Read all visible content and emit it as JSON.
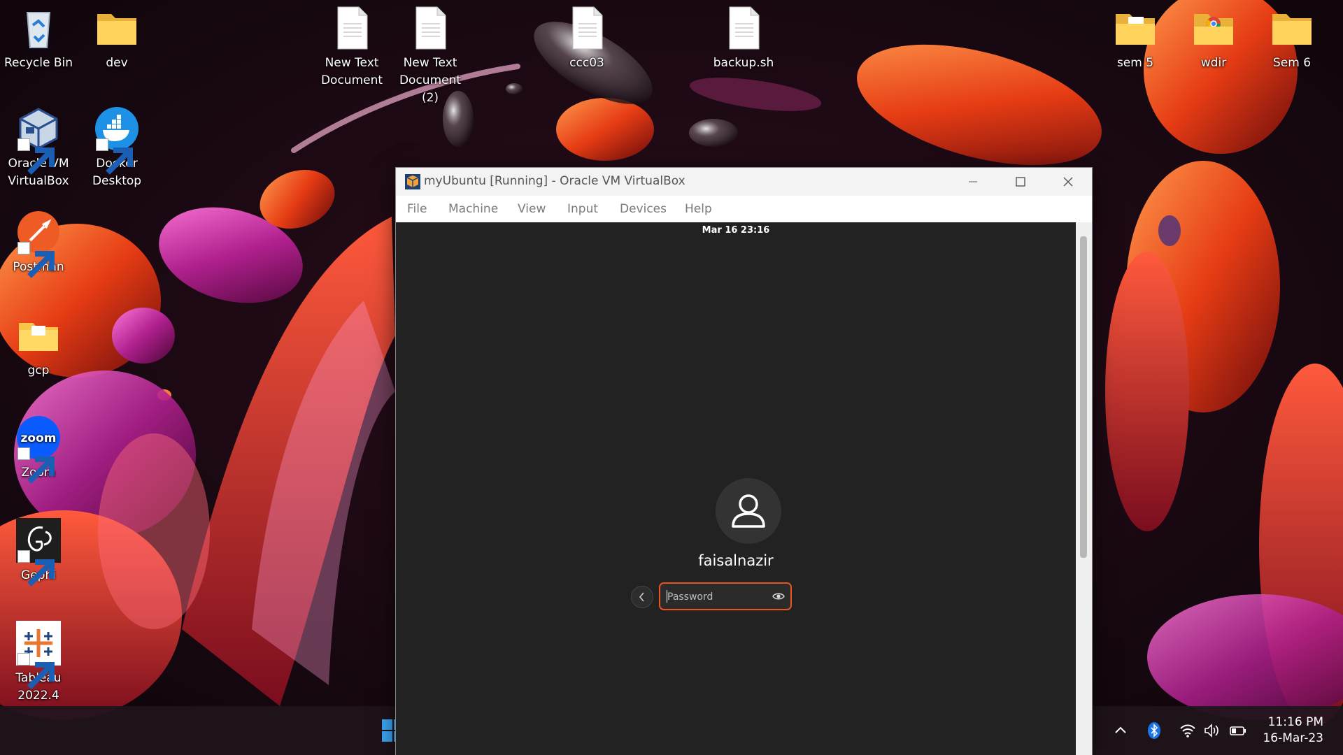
{
  "desktop": {
    "icons": [
      {
        "label": "Recycle Bin",
        "icon": "recycle-bin-icon"
      },
      {
        "label": "dev",
        "icon": "folder-icon"
      },
      {
        "label": "New Text Document",
        "icon": "text-file-icon"
      },
      {
        "label": "New Text Document (2)",
        "icon": "text-file-icon"
      },
      {
        "label": "ccc03",
        "icon": "text-file-icon"
      },
      {
        "label": "backup.sh",
        "icon": "text-file-icon"
      },
      {
        "label": "sem 5",
        "icon": "folder-icon"
      },
      {
        "label": "wdir",
        "icon": "folder-chrome-icon"
      },
      {
        "label": "Sem 6",
        "icon": "folder-icon"
      },
      {
        "label": "Oracle VM VirtualBox",
        "icon": "virtualbox-icon"
      },
      {
        "label": "Docker Desktop",
        "icon": "docker-icon"
      },
      {
        "label": "Postman",
        "icon": "postman-icon"
      },
      {
        "label": "gcp",
        "icon": "folder-icon"
      },
      {
        "label": "Zoom",
        "icon": "zoom-icon"
      },
      {
        "label": "Gephi",
        "icon": "gephi-icon"
      },
      {
        "label": "Tableau 2022.4",
        "icon": "tableau-icon"
      }
    ],
    "zoom_logo_text": "zoom"
  },
  "window": {
    "title": "myUbuntu [Running] - Oracle VM VirtualBox",
    "menu": [
      "File",
      "Machine",
      "View",
      "Input",
      "Devices",
      "Help"
    ]
  },
  "guest": {
    "clock": "Mar 16  23:16",
    "username": "faisalnazir",
    "password_placeholder": "Password",
    "accent_color": "#e95420"
  },
  "taskbar": {
    "time": "11:16 PM",
    "date": "16-Mar-23",
    "tray_icons": [
      "chevron-up-icon",
      "bluetooth-icon",
      "wifi-icon",
      "volume-icon",
      "battery-icon"
    ]
  }
}
